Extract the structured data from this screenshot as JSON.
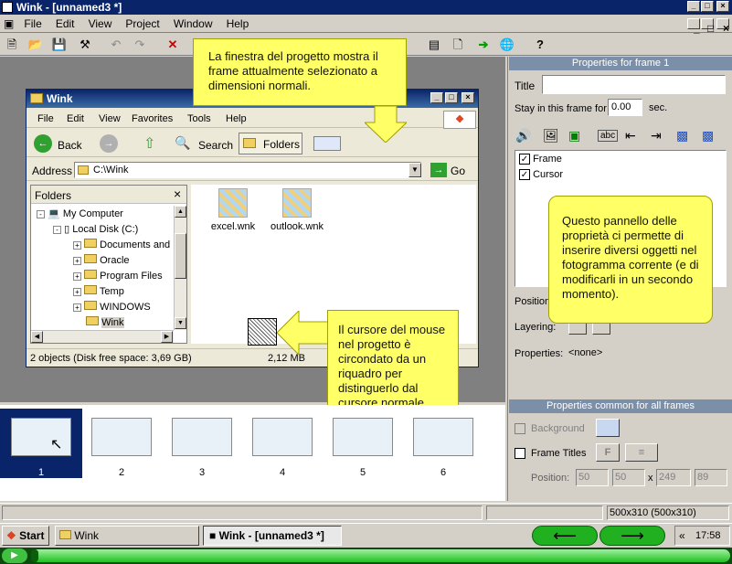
{
  "app": {
    "title": "Wink - [unnamed3 *]",
    "menu": [
      "File",
      "Edit",
      "View",
      "Project",
      "Window",
      "Help"
    ]
  },
  "explorer": {
    "title": "Wink",
    "menu": [
      "File",
      "Edit",
      "View",
      "Favorites",
      "Tools",
      "Help"
    ],
    "back_label": "Back",
    "search_label": "Search",
    "folders_label": "Folders",
    "address_label": "Address",
    "address_value": "C:\\Wink",
    "go_label": "Go",
    "folders_title": "Folders",
    "tree": [
      {
        "label": "My Computer",
        "indent": 0
      },
      {
        "label": "Local Disk (C:)",
        "indent": 1
      },
      {
        "label": "Documents and",
        "indent": 2
      },
      {
        "label": "Oracle",
        "indent": 2
      },
      {
        "label": "Program Files",
        "indent": 2
      },
      {
        "label": "Temp",
        "indent": 2
      },
      {
        "label": "WINDOWS",
        "indent": 2
      },
      {
        "label": "Wink",
        "indent": 2
      }
    ],
    "files": [
      "excel.wnk",
      "outlook.wnk"
    ],
    "status_left": "2 objects (Disk free space: 3,69 GB)",
    "status_right": "2,12 MB"
  },
  "callouts": {
    "top": "La finestra del progetto mostra il frame attualmente selezionato a dimensioni normali.",
    "cursor": "Il cursore del mouse nel progetto è circondato da un riquadro per distinguerlo dal cursore normale.",
    "properties": "Questo  pannello delle proprietà  ci permette di inserire diversi oggetti nel fotogramma corrente (e di modificarli in un secondo momento)."
  },
  "properties": {
    "header": "Properties for frame 1",
    "title_label": "Title",
    "title_value": "",
    "stay_label": "Stay in this frame for",
    "stay_value": "0.00",
    "stay_unit": "sec.",
    "items": [
      {
        "label": "Frame",
        "checked": true
      },
      {
        "label": "Cursor",
        "checked": true
      }
    ],
    "position_label": "Position",
    "layering_label": "Layering:",
    "props_label": "Properties:",
    "props_value": "<none>"
  },
  "common": {
    "header": "Properties common for all frames",
    "background_label": "Background",
    "frame_titles_label": "Frame Titles",
    "position_label": "Position:",
    "pos_x": "50",
    "pos_y": "50",
    "pos_sep": "x",
    "pos_w": "249",
    "pos_h": "89"
  },
  "thumbnails": [
    "1",
    "2",
    "3",
    "4",
    "5",
    "6"
  ],
  "statusbar": {
    "size_text": "500x310 (500x310)"
  },
  "taskbar": {
    "start_label": "Start",
    "tasks": [
      "Wink",
      "Wink - [unnamed3 *]"
    ],
    "tray_chevron": "«",
    "clock": "17:58"
  },
  "playback": {
    "progress": 0.01
  },
  "colors": {
    "accent": "#0a246a",
    "callout": "#ffff66",
    "progress": "#00c000"
  }
}
